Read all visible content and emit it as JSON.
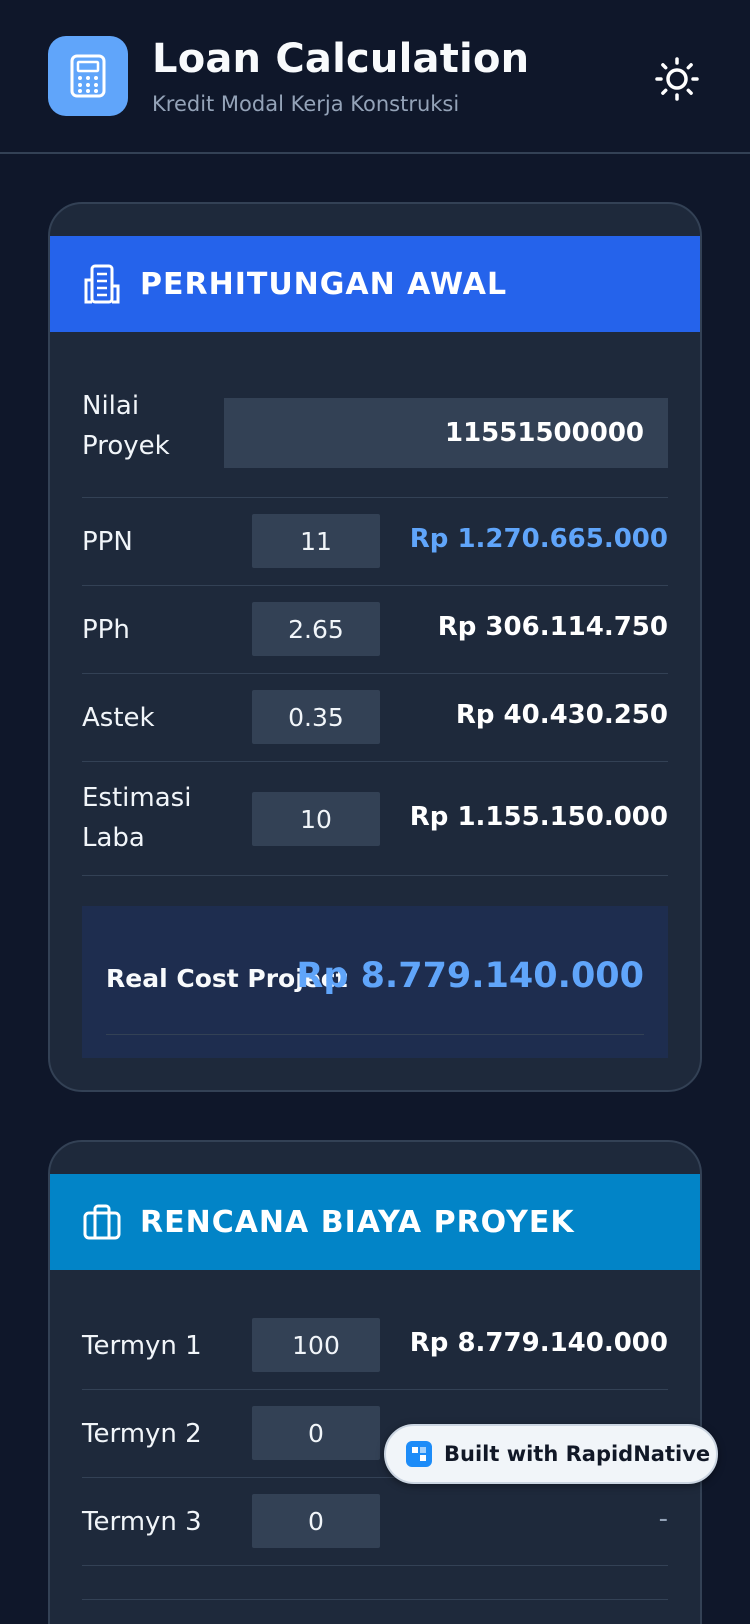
{
  "header": {
    "title": "Loan Calculation",
    "subtitle": "Kredit Modal Kerja Konstruksi",
    "app_icon": "calculator-icon",
    "theme_icon": "sun-icon"
  },
  "colors": {
    "background": "#0f172a",
    "card": "#1e293b",
    "card1_header": "#2563eb",
    "card2_header": "#0284c7",
    "accent": "#60a5fa"
  },
  "card1": {
    "title": "PERHITUNGAN AWAL",
    "icon": "building-icon",
    "nilai_proyek": {
      "label": "Nilai Proyek",
      "value": "11551500000"
    },
    "rows": [
      {
        "label": "PPN",
        "input": "11",
        "value": "Rp 1.270.665.000"
      },
      {
        "label": "PPh",
        "input": "2.65",
        "value": "Rp 306.114.750"
      },
      {
        "label": "Astek",
        "input": "0.35",
        "value": "Rp 40.430.250"
      },
      {
        "label": "Estimasi Laba",
        "input": "10",
        "value": "Rp 1.155.150.000"
      }
    ],
    "real_cost": {
      "label": "Real Cost Project",
      "value": "Rp 8.779.140.000"
    }
  },
  "card2": {
    "title": "RENCANA BIAYA PROYEK",
    "icon": "briefcase-icon",
    "rows": [
      {
        "label": "Termyn 1",
        "input": "100",
        "value": "Rp 8.779.140.000"
      },
      {
        "label": "Termyn 2",
        "input": "0",
        "value": ""
      },
      {
        "label": "Termyn 3",
        "input": "0",
        "value": "-"
      }
    ]
  },
  "badge": {
    "text": "Built with RapidNative",
    "icon": "rapidnative-logo-icon"
  }
}
